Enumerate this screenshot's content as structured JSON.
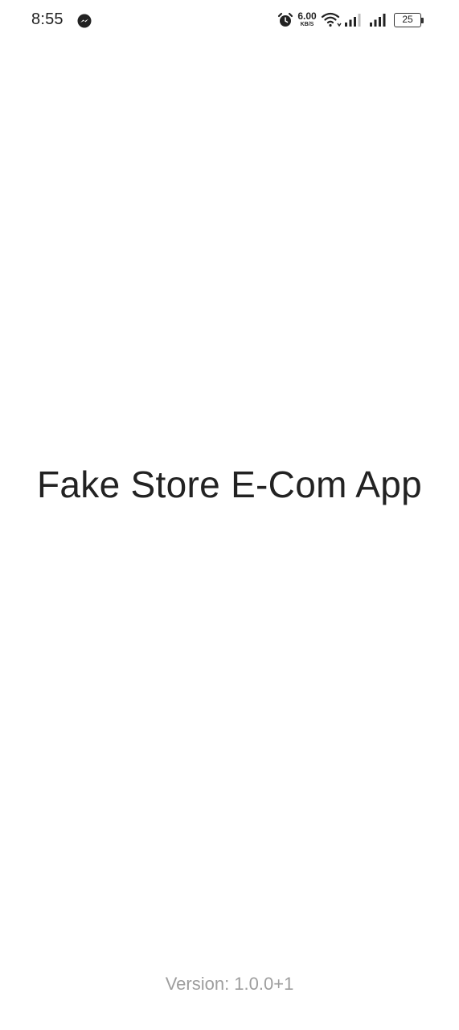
{
  "status_bar": {
    "time": "8:55",
    "network_speed_value": "6.00",
    "network_speed_unit": "KB/S",
    "battery_level": "25",
    "icons": [
      "messenger-icon",
      "alarm-icon",
      "wifi-icon",
      "signal-icon",
      "signal-icon",
      "battery-icon"
    ]
  },
  "splash": {
    "app_title": "Fake Store E-Com App",
    "version": "Version: 1.0.0+1"
  },
  "colors": {
    "background": "#ffffff",
    "title_text": "#222222",
    "version_text": "#9e9e9e"
  }
}
